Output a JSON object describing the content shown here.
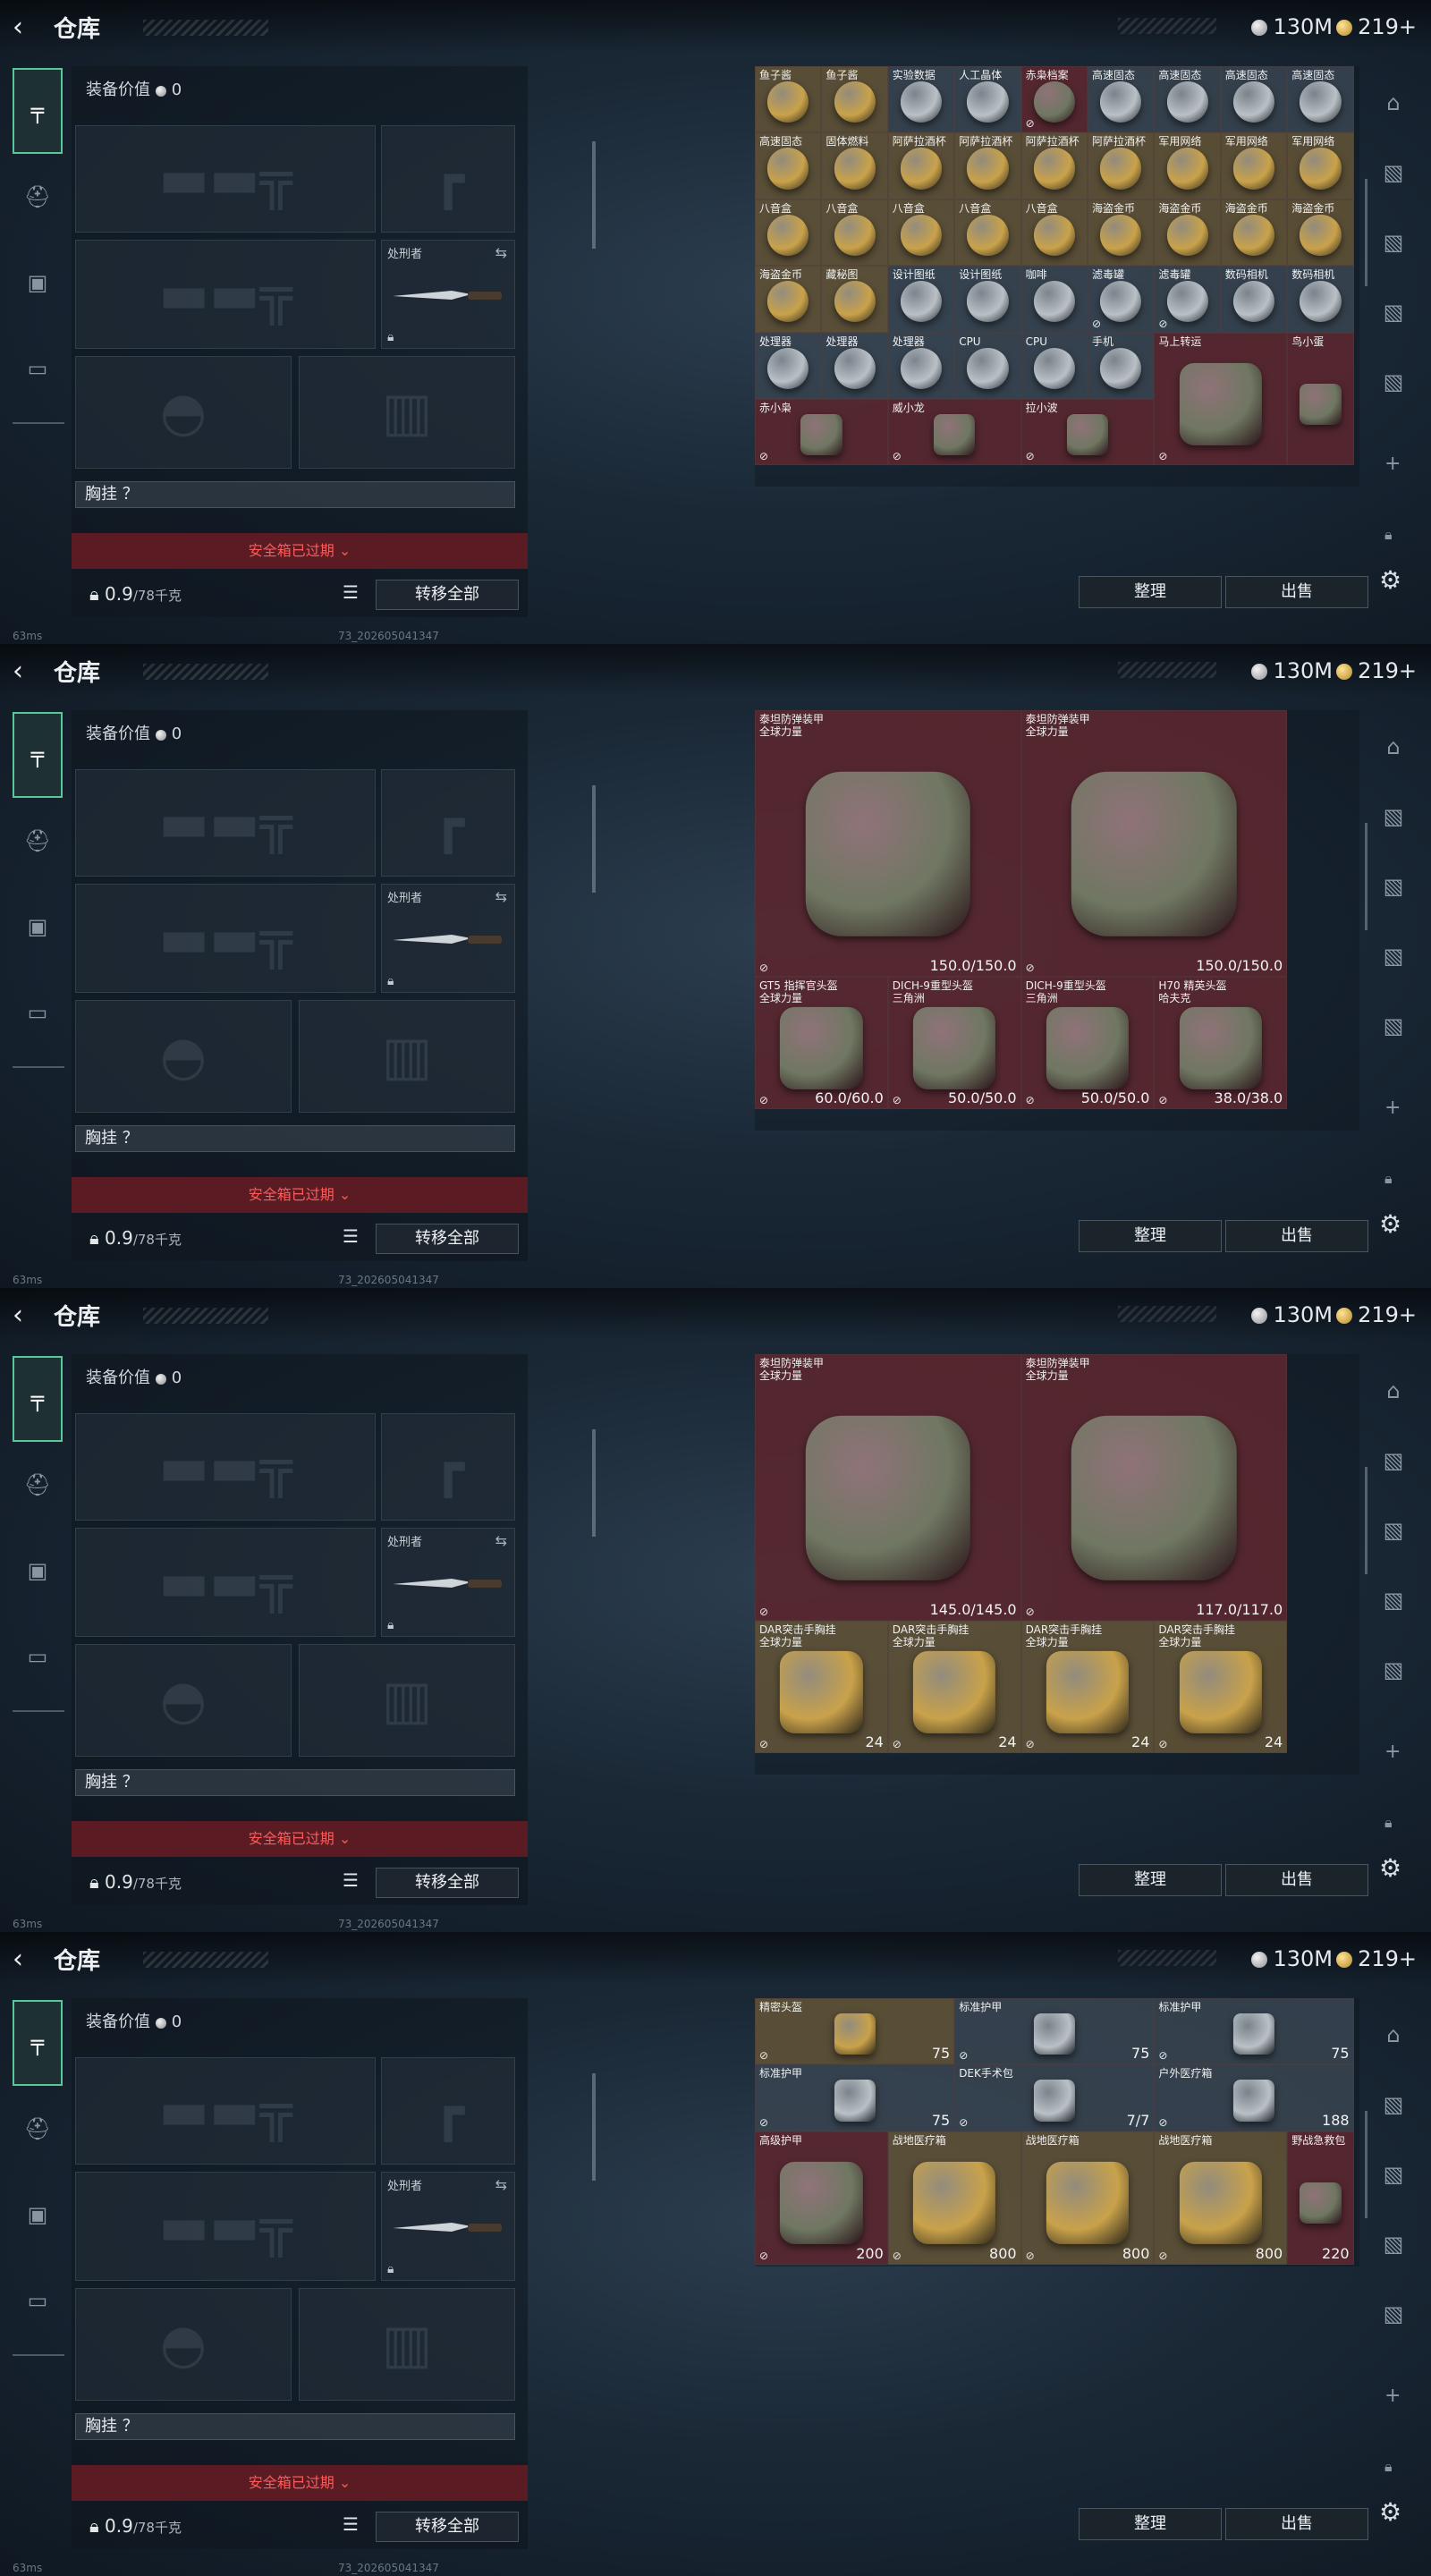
{
  "header": {
    "back": "‹",
    "title": "仓库",
    "money": "130M",
    "gold": "219+"
  },
  "equip": {
    "value_label": "装备价值",
    "value": "0",
    "slot_knife_label": "处刑者",
    "vest_label": "胸挂 ？",
    "safe_box": "安全箱已过期",
    "weight": "0.9",
    "weight_cap": "/78千克",
    "move_all": "转移全部"
  },
  "actions": {
    "sort": "整理",
    "sell": "出售"
  },
  "status": {
    "ping": "63ms",
    "build": "73_202605041347"
  },
  "colors": {
    "accent": "#58c79a",
    "safe_red": "#ff5a5a",
    "cell_red": "#5f2830"
  },
  "panels": [
    {
      "cells": [
        {
          "n": "鱼子酱",
          "c": "b",
          "x": 0,
          "y": 0,
          "w": 1,
          "h": 1
        },
        {
          "n": "鱼子酱",
          "c": "b",
          "x": 1,
          "y": 0,
          "w": 1,
          "h": 1
        },
        {
          "n": "实验数据",
          "c": "g",
          "x": 2,
          "y": 0,
          "w": 1,
          "h": 1
        },
        {
          "n": "人工晶体",
          "c": "g",
          "x": 3,
          "y": 0,
          "w": 1,
          "h": 1
        },
        {
          "n": "赤枭档案",
          "c": "r",
          "x": 4,
          "y": 0,
          "w": 1,
          "h": 1
        },
        {
          "n": "高速固态",
          "c": "g",
          "x": 5,
          "y": 0,
          "w": 1,
          "h": 1
        },
        {
          "n": "高速固态",
          "c": "g",
          "x": 6,
          "y": 0,
          "w": 1,
          "h": 1
        },
        {
          "n": "高速固态",
          "c": "g",
          "x": 7,
          "y": 0,
          "w": 1,
          "h": 1
        },
        {
          "n": "高速固态",
          "c": "g",
          "x": 8,
          "y": 0,
          "w": 1,
          "h": 1
        },
        {
          "n": "高速固态",
          "c": "b",
          "x": 0,
          "y": 1,
          "w": 1,
          "h": 1
        },
        {
          "n": "固体燃料",
          "c": "b",
          "x": 1,
          "y": 1,
          "w": 1,
          "h": 1
        },
        {
          "n": "阿萨拉酒杯",
          "c": "b",
          "x": 2,
          "y": 1,
          "w": 1,
          "h": 1
        },
        {
          "n": "阿萨拉酒杯",
          "c": "b",
          "x": 3,
          "y": 1,
          "w": 1,
          "h": 1
        },
        {
          "n": "阿萨拉酒杯",
          "c": "b",
          "x": 4,
          "y": 1,
          "w": 1,
          "h": 1
        },
        {
          "n": "阿萨拉酒杯",
          "c": "b",
          "x": 5,
          "y": 1,
          "w": 1,
          "h": 1
        },
        {
          "n": "军用网络",
          "c": "b",
          "x": 6,
          "y": 1,
          "w": 1,
          "h": 1
        },
        {
          "n": "军用网络",
          "c": "b",
          "x": 7,
          "y": 1,
          "w": 1,
          "h": 1
        },
        {
          "n": "军用网络",
          "c": "b",
          "x": 8,
          "y": 1,
          "w": 1,
          "h": 1
        },
        {
          "n": "八音盒",
          "c": "b",
          "x": 0,
          "y": 2,
          "w": 1,
          "h": 1
        },
        {
          "n": "八音盒",
          "c": "b",
          "x": 1,
          "y": 2,
          "w": 1,
          "h": 1
        },
        {
          "n": "八音盒",
          "c": "b",
          "x": 2,
          "y": 2,
          "w": 1,
          "h": 1
        },
        {
          "n": "八音盒",
          "c": "b",
          "x": 3,
          "y": 2,
          "w": 1,
          "h": 1
        },
        {
          "n": "八音盒",
          "c": "b",
          "x": 4,
          "y": 2,
          "w": 1,
          "h": 1
        },
        {
          "n": "海盗金币",
          "c": "b",
          "x": 5,
          "y": 2,
          "w": 1,
          "h": 1
        },
        {
          "n": "海盗金币",
          "c": "b",
          "x": 6,
          "y": 2,
          "w": 1,
          "h": 1
        },
        {
          "n": "海盗金币",
          "c": "b",
          "x": 7,
          "y": 2,
          "w": 1,
          "h": 1
        },
        {
          "n": "海盗金币",
          "c": "b",
          "x": 8,
          "y": 2,
          "w": 1,
          "h": 1
        },
        {
          "n": "海盗金币",
          "c": "b",
          "x": 0,
          "y": 3,
          "w": 1,
          "h": 1
        },
        {
          "n": "藏秘图",
          "c": "b",
          "x": 1,
          "y": 3,
          "w": 1,
          "h": 1
        },
        {
          "n": "设计图纸",
          "c": "g",
          "x": 2,
          "y": 3,
          "w": 1,
          "h": 1
        },
        {
          "n": "设计图纸",
          "c": "g",
          "x": 3,
          "y": 3,
          "w": 1,
          "h": 1
        },
        {
          "n": "咖啡",
          "c": "g",
          "x": 4,
          "y": 3,
          "w": 1,
          "h": 1
        },
        {
          "n": "滤毒罐",
          "c": "g",
          "x": 5,
          "y": 3,
          "w": 1,
          "h": 1
        },
        {
          "n": "滤毒罐",
          "c": "g",
          "x": 6,
          "y": 3,
          "w": 1,
          "h": 1
        },
        {
          "n": "数码相机",
          "c": "g",
          "x": 7,
          "y": 3,
          "w": 1,
          "h": 1
        },
        {
          "n": "数码相机",
          "c": "g",
          "x": 8,
          "y": 3,
          "w": 1,
          "h": 1
        },
        {
          "n": "处理器",
          "c": "g",
          "x": 0,
          "y": 4,
          "w": 1,
          "h": 1
        },
        {
          "n": "处理器",
          "c": "g",
          "x": 1,
          "y": 4,
          "w": 1,
          "h": 1
        },
        {
          "n": "处理器",
          "c": "g",
          "x": 2,
          "y": 4,
          "w": 1,
          "h": 1
        },
        {
          "n": "CPU",
          "c": "g",
          "x": 3,
          "y": 4,
          "w": 1,
          "h": 1
        },
        {
          "n": "CPU",
          "c": "g",
          "x": 4,
          "y": 4,
          "w": 1,
          "h": 1
        },
        {
          "n": "手机",
          "c": "g",
          "x": 5,
          "y": 4,
          "w": 1,
          "h": 1
        },
        {
          "n": "马上转运",
          "c": "r",
          "x": 6,
          "y": 4,
          "w": 2,
          "h": 2
        },
        {
          "n": "鸟小蛋",
          "c": "r",
          "x": 8,
          "y": 4,
          "w": 1,
          "h": 2
        },
        {
          "n": "赤小枭",
          "c": "r",
          "x": 0,
          "y": 5,
          "w": 2,
          "h": 1
        },
        {
          "n": "威小龙",
          "c": "r",
          "x": 2,
          "y": 5,
          "w": 2,
          "h": 1
        },
        {
          "n": "拉小波",
          "c": "r",
          "x": 4,
          "y": 5,
          "w": 2,
          "h": 1
        }
      ]
    },
    {
      "cells": [
        {
          "n": "泰坦防弹装甲",
          "s": "全球力量",
          "c": "r",
          "x": 0,
          "y": 0,
          "w": 4,
          "h": 4,
          "v": "150.0/150.0"
        },
        {
          "n": "泰坦防弹装甲",
          "s": "全球力量",
          "c": "r",
          "x": 4,
          "y": 0,
          "w": 4,
          "h": 4,
          "v": "150.0/150.0"
        },
        {
          "n": "GT5 指挥官头盔",
          "s": "全球力量",
          "c": "r",
          "x": 0,
          "y": 4,
          "w": 2,
          "h": 2,
          "v": "60.0/60.0"
        },
        {
          "n": "DICH-9重型头盔",
          "s": "三角洲",
          "c": "r",
          "x": 2,
          "y": 4,
          "w": 2,
          "h": 2,
          "v": "50.0/50.0"
        },
        {
          "n": "DICH-9重型头盔",
          "s": "三角洲",
          "c": "r",
          "x": 4,
          "y": 4,
          "w": 2,
          "h": 2,
          "v": "50.0/50.0"
        },
        {
          "n": "H70 精英头盔",
          "s": "哈夫克",
          "c": "r",
          "x": 6,
          "y": 4,
          "w": 2,
          "h": 2,
          "v": "38.0/38.0"
        }
      ]
    },
    {
      "cells": [
        {
          "n": "泰坦防弹装甲",
          "s": "全球力量",
          "c": "r",
          "x": 0,
          "y": 0,
          "w": 4,
          "h": 4,
          "v": "145.0/145.0"
        },
        {
          "n": "泰坦防弹装甲",
          "s": "全球力量",
          "c": "r",
          "x": 4,
          "y": 0,
          "w": 4,
          "h": 4,
          "v": "117.0/117.0"
        },
        {
          "n": "DAR突击手胸挂",
          "s": "全球力量",
          "c": "b",
          "x": 0,
          "y": 4,
          "w": 2,
          "h": 2,
          "v": "24"
        },
        {
          "n": "DAR突击手胸挂",
          "s": "全球力量",
          "c": "b",
          "x": 2,
          "y": 4,
          "w": 2,
          "h": 2,
          "v": "24"
        },
        {
          "n": "DAR突击手胸挂",
          "s": "全球力量",
          "c": "b",
          "x": 4,
          "y": 4,
          "w": 2,
          "h": 2,
          "v": "24"
        },
        {
          "n": "DAR突击手胸挂",
          "s": "全球力量",
          "c": "b",
          "x": 6,
          "y": 4,
          "w": 2,
          "h": 2,
          "v": "24"
        }
      ]
    },
    {
      "cells": [
        {
          "n": "精密头盔",
          "c": "b",
          "x": 0,
          "y": 0,
          "w": 3,
          "h": 1,
          "v": "75"
        },
        {
          "n": "标准护甲",
          "c": "g",
          "x": 3,
          "y": 0,
          "w": 3,
          "h": 1,
          "v": "75"
        },
        {
          "n": "标准护甲",
          "c": "g",
          "x": 6,
          "y": 0,
          "w": 3,
          "h": 1,
          "v": "75"
        },
        {
          "n": "标准护甲",
          "c": "g",
          "x": 0,
          "y": 1,
          "w": 3,
          "h": 1,
          "v": "75"
        },
        {
          "n": "DEK手术包",
          "c": "g",
          "x": 3,
          "y": 1,
          "w": 3,
          "h": 1,
          "v": "7/7"
        },
        {
          "n": "户外医疗箱",
          "c": "g",
          "x": 6,
          "y": 1,
          "w": 3,
          "h": 1,
          "v": "188"
        },
        {
          "n": "高级护甲",
          "c": "r",
          "x": 0,
          "y": 2,
          "w": 2,
          "h": 2,
          "v": "200"
        },
        {
          "n": "战地医疗箱",
          "c": "b",
          "x": 2,
          "y": 2,
          "w": 2,
          "h": 2,
          "v": "800"
        },
        {
          "n": "战地医疗箱",
          "c": "b",
          "x": 4,
          "y": 2,
          "w": 2,
          "h": 2,
          "v": "800"
        },
        {
          "n": "战地医疗箱",
          "c": "b",
          "x": 6,
          "y": 2,
          "w": 2,
          "h": 2,
          "v": "800"
        },
        {
          "n": "野战急救包",
          "c": "r",
          "x": 8,
          "y": 2,
          "w": 1,
          "h": 2,
          "v": "220"
        }
      ]
    }
  ]
}
